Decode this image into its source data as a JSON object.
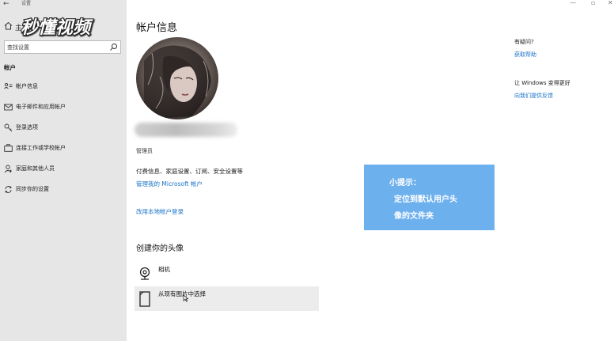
{
  "window": {
    "title": "设置",
    "back_glyph": "←",
    "min_glyph": "—",
    "max_glyph": "▫",
    "close_glyph": "✕"
  },
  "logo_text": "秒懂视频",
  "sidebar": {
    "home_label": "主",
    "search": {
      "placeholder": "查找设置",
      "value": ""
    },
    "section_label": "帐户",
    "items": [
      {
        "label": "帐户信息",
        "icon": "person-card-icon",
        "active": true
      },
      {
        "label": "电子邮件和应用帐户",
        "icon": "mail-icon",
        "active": false
      },
      {
        "label": "登录选项",
        "icon": "key-icon",
        "active": false
      },
      {
        "label": "连接工作或学校帐户",
        "icon": "briefcase-icon",
        "active": false
      },
      {
        "label": "家庭和其他人员",
        "icon": "person-icon",
        "active": false
      },
      {
        "label": "同步你的设置",
        "icon": "sync-icon",
        "active": false
      }
    ]
  },
  "main": {
    "title": "帐户信息",
    "role": "管理员",
    "billing_text": "付费信息、家庭设置、订阅、安全设置等",
    "manage_link": "管理我的 Microsoft 帐户",
    "local_link": "改用本地帐户登录",
    "create_heading": "创建你的头像",
    "options": [
      {
        "label": "相机",
        "icon": "camera-icon"
      },
      {
        "label": "从现有图片中选择",
        "icon": "picture-file-icon"
      }
    ]
  },
  "tip": {
    "title": "小提示：",
    "line1": "定位到默认用户头",
    "line2": "像的文件夹",
    "color": "#6db0ee"
  },
  "help": {
    "question": "有疑问?",
    "link": "获取帮助",
    "feedback_question": "让 Windows 变得更好",
    "feedback_link": "向我们提供反馈"
  },
  "colors": {
    "link": "#1a73c8",
    "sidebar_bg": "#e6e6e6"
  }
}
